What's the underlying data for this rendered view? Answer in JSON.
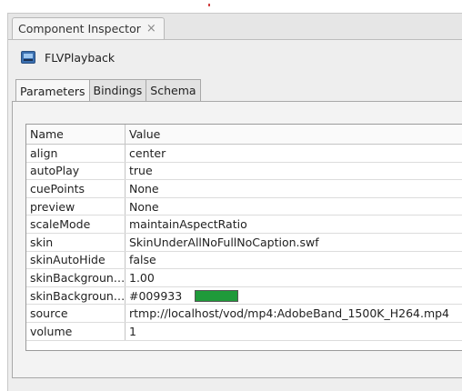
{
  "panel": {
    "tab_title": "Component Inspector",
    "close_glyph": "×"
  },
  "component": {
    "name": "FLVPlayback",
    "icon": "flv-component-icon"
  },
  "tabs": [
    {
      "label": "Parameters",
      "active": true
    },
    {
      "label": "Bindings",
      "active": false
    },
    {
      "label": "Schema",
      "active": false
    }
  ],
  "grid": {
    "headers": {
      "name": "Name",
      "value": "Value"
    },
    "rows": [
      {
        "name": "align",
        "value": "center"
      },
      {
        "name": "autoPlay",
        "value": "true"
      },
      {
        "name": "cuePoints",
        "value": "None"
      },
      {
        "name": "preview",
        "value": "None"
      },
      {
        "name": "scaleMode",
        "value": "maintainAspectRatio"
      },
      {
        "name": "skin",
        "value": "SkinUnderAllNoFullNoCaption.swf"
      },
      {
        "name": "skinAutoHide",
        "value": "false"
      },
      {
        "name": "skinBackgroun…",
        "value": "1.00"
      },
      {
        "name": "skinBackgroun…",
        "value": "#009933",
        "swatch": "#1f9a3a"
      },
      {
        "name": "source",
        "value": "rtmp://localhost/vod/mp4:AdobeBand_1500K_H264.mp4"
      },
      {
        "name": "volume",
        "value": "1"
      }
    ]
  }
}
